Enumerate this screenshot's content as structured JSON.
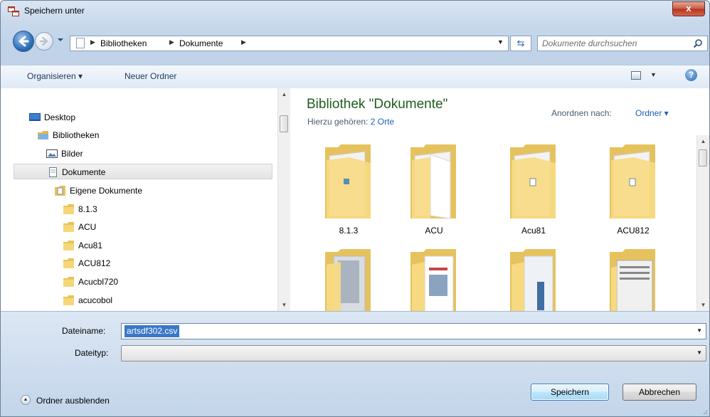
{
  "window": {
    "title": "Speichern unter",
    "close_label": "x"
  },
  "address": {
    "crumbs": [
      "Bibliotheken",
      "Dokumente"
    ],
    "search_placeholder": "Dokumente durchsuchen"
  },
  "toolbar": {
    "organize_label": "Organisieren ▾",
    "new_folder_label": "Neuer Ordner",
    "help_label": "?"
  },
  "tree": {
    "items": [
      {
        "label": "Desktop",
        "icon": "desktop-icon"
      },
      {
        "label": "Bibliotheken",
        "icon": "libraries-icon"
      },
      {
        "label": "Bilder",
        "icon": "pictures-library-icon"
      },
      {
        "label": "Dokumente",
        "icon": "documents-library-icon",
        "selected": true
      },
      {
        "label": "Eigene Dokumente",
        "icon": "documents-folder-icon"
      },
      {
        "label": "8.1.3",
        "icon": "folder-icon"
      },
      {
        "label": "ACU",
        "icon": "folder-icon"
      },
      {
        "label": "Acu81",
        "icon": "folder-icon"
      },
      {
        "label": "ACU812",
        "icon": "folder-icon"
      },
      {
        "label": "Acucbl720",
        "icon": "folder-icon"
      },
      {
        "label": "acucobol",
        "icon": "folder-icon"
      }
    ]
  },
  "library": {
    "title": "Bibliothek \"Dokumente\"",
    "subtitle_prefix": "Hierzu gehören:",
    "subtitle_link": "2 Orte",
    "arrange_label": "Anordnen nach:",
    "arrange_value": "Ordner ▾"
  },
  "folders": [
    {
      "label": "8.1.3",
      "icon": "folder-large-icon"
    },
    {
      "label": "ACU",
      "icon": "folder-large-icon"
    },
    {
      "label": "Acu81",
      "icon": "folder-large-icon"
    },
    {
      "label": "ACU812",
      "icon": "folder-large-icon"
    },
    {
      "label": "",
      "icon": "folder-large-icon"
    },
    {
      "label": "",
      "icon": "folder-large-icon"
    },
    {
      "label": "",
      "icon": "folder-large-icon"
    },
    {
      "label": "",
      "icon": "folder-large-icon"
    }
  ],
  "form": {
    "filename_label": "Dateiname:",
    "filename_value": "artsdf302.csv",
    "filetype_label": "Dateityp:",
    "filetype_value": ""
  },
  "footer": {
    "hide_folders_label": "Ordner ausblenden",
    "save_label": "Speichern",
    "cancel_label": "Abbrechen"
  }
}
